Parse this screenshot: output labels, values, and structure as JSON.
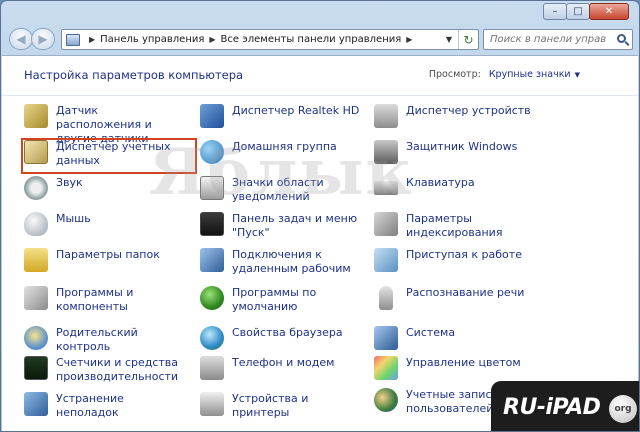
{
  "window": {
    "controls": {
      "minimize": "–",
      "maximize": "□",
      "close": "✕"
    }
  },
  "nav": {
    "back_icon": "back-arrow-icon",
    "forward_icon": "forward-arrow-icon",
    "breadcrumbs": [
      "Панель управления",
      "Все элементы панели управления"
    ],
    "refresh_icon": "refresh-icon"
  },
  "search": {
    "placeholder": "Поиск в панели управления",
    "value": ""
  },
  "header": {
    "title": "Настройка параметров компьютера",
    "view_label": "Просмотр:",
    "view_value": "Крупные значки"
  },
  "items": [
    {
      "label": "Датчик расположения и другие датчики",
      "icon": "sensor-icon"
    },
    {
      "label": "Диспетчер Realtek HD",
      "icon": "realtek-audio-icon"
    },
    {
      "label": "Диспетчер устройств",
      "icon": "device-manager-icon"
    },
    {
      "label": "Диспетчер учетных данных",
      "icon": "credential-manager-icon"
    },
    {
      "label": "Домашняя группа",
      "icon": "homegroup-icon"
    },
    {
      "label": "Защитник Windows",
      "icon": "windows-defender-icon"
    },
    {
      "label": "Звук",
      "icon": "sound-icon"
    },
    {
      "label": "Значки области уведомлений",
      "icon": "notification-icons-icon"
    },
    {
      "label": "Клавиатура",
      "icon": "keyboard-icon"
    },
    {
      "label": "Мышь",
      "icon": "mouse-icon"
    },
    {
      "label": "Панель задач и меню \"Пуск\"",
      "icon": "taskbar-icon"
    },
    {
      "label": "Параметры индексирования",
      "icon": "indexing-icon"
    },
    {
      "label": "Параметры папок",
      "icon": "folder-options-icon"
    },
    {
      "label": "Подключения к удаленным рабочим",
      "icon": "remote-desktop-icon"
    },
    {
      "label": "Приступая к работе",
      "icon": "getting-started-icon"
    },
    {
      "label": "Программы и компоненты",
      "icon": "programs-features-icon"
    },
    {
      "label": "Программы по умолчанию",
      "icon": "default-programs-icon"
    },
    {
      "label": "Распознавание речи",
      "icon": "speech-recognition-icon"
    },
    {
      "label": "Родительский контроль",
      "icon": "parental-controls-icon"
    },
    {
      "label": "Свойства браузера",
      "icon": "internet-options-icon"
    },
    {
      "label": "Система",
      "icon": "system-icon"
    },
    {
      "label": "Счетчики и средства производительности",
      "icon": "performance-icon"
    },
    {
      "label": "Телефон и модем",
      "icon": "phone-modem-icon"
    },
    {
      "label": "Управление цветом",
      "icon": "color-management-icon"
    },
    {
      "label": "Устранение неполадок",
      "icon": "troubleshooting-icon"
    },
    {
      "label": "Устройства и принтеры",
      "icon": "devices-printers-icon"
    },
    {
      "label": "Учетные записи пользователей",
      "icon": "user-accounts-icon"
    }
  ],
  "watermarks": {
    "center": "Яблык",
    "corner": "RU-iPAD",
    "corner_suffix": "org"
  },
  "colors": {
    "link": "#1e3287",
    "highlight": "#d4431f"
  }
}
